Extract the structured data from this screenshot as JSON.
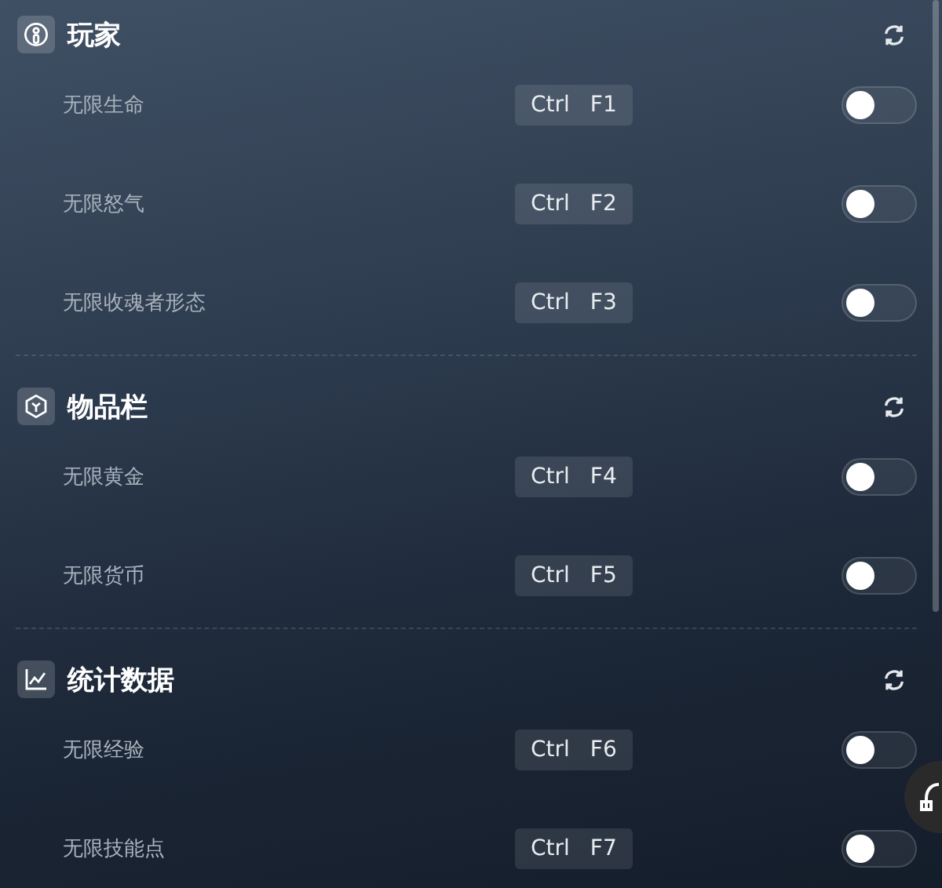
{
  "sections": [
    {
      "title": "玩家",
      "kind": "player",
      "rows": [
        {
          "label": "无限生命",
          "keys": [
            "Ctrl",
            "F1"
          ],
          "on": false
        },
        {
          "label": "无限怒气",
          "keys": [
            "Ctrl",
            "F2"
          ],
          "on": false
        },
        {
          "label": "无限收魂者形态",
          "keys": [
            "Ctrl",
            "F3"
          ],
          "on": false
        }
      ]
    },
    {
      "title": "物品栏",
      "kind": "box",
      "rows": [
        {
          "label": "无限黄金",
          "keys": [
            "Ctrl",
            "F4"
          ],
          "on": false
        },
        {
          "label": "无限货币",
          "keys": [
            "Ctrl",
            "F5"
          ],
          "on": false
        }
      ]
    },
    {
      "title": "统计数据",
      "kind": "chart",
      "rows": [
        {
          "label": "无限经验",
          "keys": [
            "Ctrl",
            "F6"
          ],
          "on": false
        },
        {
          "label": "无限技能点",
          "keys": [
            "Ctrl",
            "F7"
          ],
          "on": false
        }
      ]
    }
  ]
}
